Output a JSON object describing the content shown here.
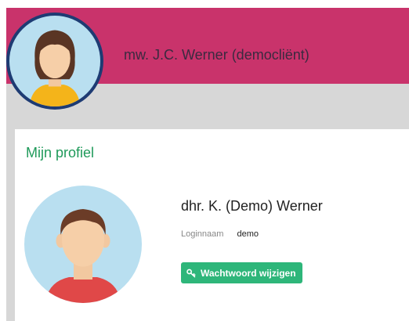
{
  "colors": {
    "header_bg": "#c9336b",
    "button_bg": "#2eb67a"
  },
  "header": {
    "user_name": "mw. J.C. Werner (democliënt)",
    "avatar_icon": "female-user-avatar-icon"
  },
  "profile": {
    "title": "Mijn profiel",
    "avatar_icon": "male-user-avatar-icon",
    "name": "dhr. K. (Demo) Werner",
    "login_label": "Loginnaam",
    "login_value": "demo",
    "change_password_label": "Wachtwoord wijzigen",
    "change_password_icon": "key-icon"
  }
}
